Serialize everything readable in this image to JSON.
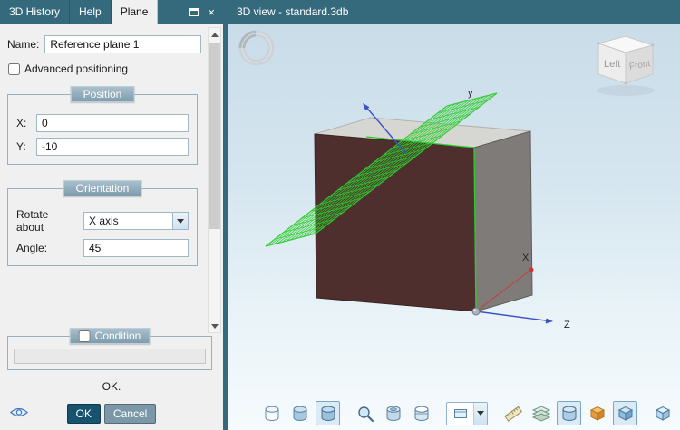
{
  "colors": {
    "titlebar": "#356a7d",
    "panel_bg": "#f0f0f0",
    "group_header": "#7f9dae",
    "ok_button": "#17536f",
    "cancel_button": "#7b98a9",
    "plane_green": "#2ecc2e",
    "cube_front": "#4f2f2e",
    "cube_side": "#7e7b78",
    "cube_top": "#d6d6d2",
    "axis_blue": "#3a52c6",
    "axis_red": "#d83030"
  },
  "left_panel": {
    "tabs": [
      {
        "label": "3D History",
        "active": false
      },
      {
        "label": "Help",
        "active": false
      },
      {
        "label": "Plane",
        "active": true
      }
    ],
    "close_icon": "×",
    "name_label": "Name:",
    "name_value": "Reference plane 1",
    "advanced_label": "Advanced positioning",
    "position": {
      "title": "Position",
      "x_label": "X:",
      "x_value": "0",
      "y_label": "Y:",
      "y_value": "-10"
    },
    "orientation": {
      "title": "Orientation",
      "rotate_label": "Rotate about",
      "rotate_value": "X axis",
      "angle_label": "Angle:",
      "angle_value": "45"
    },
    "condition": {
      "title": "Condition",
      "field_value": ""
    },
    "status": "OK.",
    "ok_label": "OK",
    "cancel_label": "Cancel"
  },
  "view": {
    "title": "3D view - standard.3db",
    "axes": {
      "x": "X",
      "y": "y",
      "z": "Z"
    },
    "nav_cube": {
      "left_face": "Left",
      "front_face": "Front"
    },
    "toolbar": {
      "more": "»",
      "items": [
        "view-glass-cylinder",
        "view-shaded-cylinder",
        "view-hidden-line-cylinder",
        "zoom",
        "view-rotate-cylinder",
        "view-clip-cylinder",
        "view-mode-dropdown",
        "measure-ruler",
        "mesh-layers",
        "shading-cylinder",
        "orange-part-cube",
        "blue-part-cube",
        "part-display-cube",
        "more-chevrons"
      ]
    }
  }
}
